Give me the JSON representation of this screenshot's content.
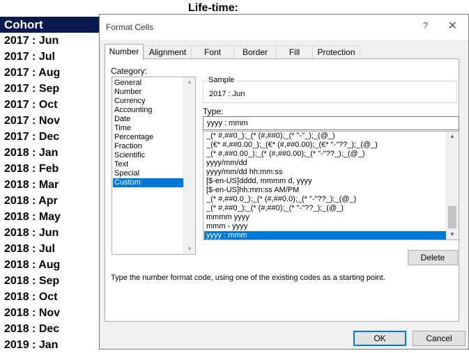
{
  "sheet": {
    "title": "Life-time:",
    "header": "Cohort",
    "rows": [
      "2017 : Jun",
      "2017 : Jul",
      "2017 : Aug",
      "2017 : Sep",
      "2017 : Oct",
      "2017 : Nov",
      "2017 : Dec",
      "2018 : Jan",
      "2018 : Feb",
      "2018 : Mar",
      "2018 : Apr",
      "2018 : May",
      "2018 : Jun",
      "2018 : Jul",
      "2018 : Aug",
      "2018 : Sep",
      "2018 : Oct",
      "2018 : Nov",
      "2018 : Dec",
      "2019 : Jan"
    ]
  },
  "dialog": {
    "title": "Format Cells",
    "help_label": "?",
    "close_label": "✕",
    "tabs": [
      "Number",
      "Alignment",
      "Font",
      "Border",
      "Fill",
      "Protection"
    ],
    "active_tab": "Number",
    "category_label": "Category:",
    "categories": [
      "General",
      "Number",
      "Currency",
      "Accounting",
      "Date",
      "Time",
      "Percentage",
      "Fraction",
      "Scientific",
      "Text",
      "Special",
      "Custom"
    ],
    "selected_category": "Custom",
    "sample_label": "Sample",
    "sample_value": "2017 : Jun",
    "type_label": "Type:",
    "type_value": "yyyy : mmm",
    "formats": [
      "_(* #,##0_);_(* (#,##0);_(* \"-\"_);_(@_)",
      "_(€* #,##0.00_);_(€* (#,##0.00);_(€* \"-\"??_);_(@_)",
      "_(* #,##0.00_);_(* (#,##0.00);_(* \"-\"??_);_(@_)",
      "yyyy/mm/dd",
      "yyyy/mm/dd hh:mm:ss",
      "[$-en-US]dddd, mmmm d, yyyy",
      "[$-en-US]hh:mm:ss AM/PM",
      "_(* #,##0.0_);_(* (#,##0.0);_(* \"-\"??_);_(@_)",
      "_(* #,##0_);_(* (#,##0);_(* \"-\"??_);_(@_)",
      "mmmm yyyy",
      "mmm - yyyy",
      "yyyy : mmm"
    ],
    "selected_format": "yyyy : mmm",
    "delete_label": "Delete",
    "hint": "Type the number format code, using one of the existing codes as a starting point.",
    "ok_label": "OK",
    "cancel_label": "Cancel",
    "colors": {
      "accent": "#0078d7",
      "cohort_header_bg": "#0b1a4e"
    },
    "icons": {
      "scroll_up": "triangle-up-icon",
      "scroll_down": "triangle-down-icon"
    }
  }
}
